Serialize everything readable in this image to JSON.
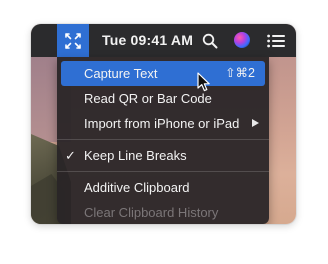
{
  "menubar": {
    "app_icon": "capture-crosshair-icon",
    "clock": "Tue 09:41 AM",
    "icons": [
      "search-icon",
      "siri-icon",
      "control-center-list-icon"
    ],
    "accent_color": "#2f6fd3"
  },
  "menu": {
    "items": [
      {
        "label": "Capture Text",
        "shortcut": "⇧⌘2",
        "state": "highlighted"
      },
      {
        "label": "Read QR or Bar Code"
      },
      {
        "label": "Import from iPhone or iPad",
        "submenu": true
      },
      {
        "label": "Keep Line Breaks",
        "checked": true,
        "check_mark": "✓"
      },
      {
        "label": "Additive Clipboard"
      },
      {
        "label": "Clear Clipboard History",
        "disabled": true
      }
    ]
  }
}
